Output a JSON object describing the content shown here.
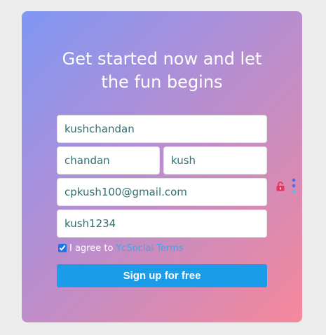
{
  "form": {
    "title_line1": "Get started now and let",
    "title_line2": "the fun begins",
    "username": "kushchandan",
    "first_name": "chandan",
    "last_name": "kush",
    "email": "cpkush100@gmail.com",
    "password": "kush1234",
    "agree_text": "I agree to",
    "terms_link": "YcSocial Terms",
    "agree_checked": true,
    "submit_label": "Sign up for free"
  },
  "icons": {
    "password_manager": "unlock-icon",
    "extension_menu": "vertical-dots-icon"
  },
  "colors": {
    "gradient_start": "#7f97f4",
    "gradient_end": "#f6889c",
    "button": "#1a9ce8",
    "link": "#3aa8ea",
    "field_text": "#2f6f72",
    "lock": "#e8335b"
  }
}
